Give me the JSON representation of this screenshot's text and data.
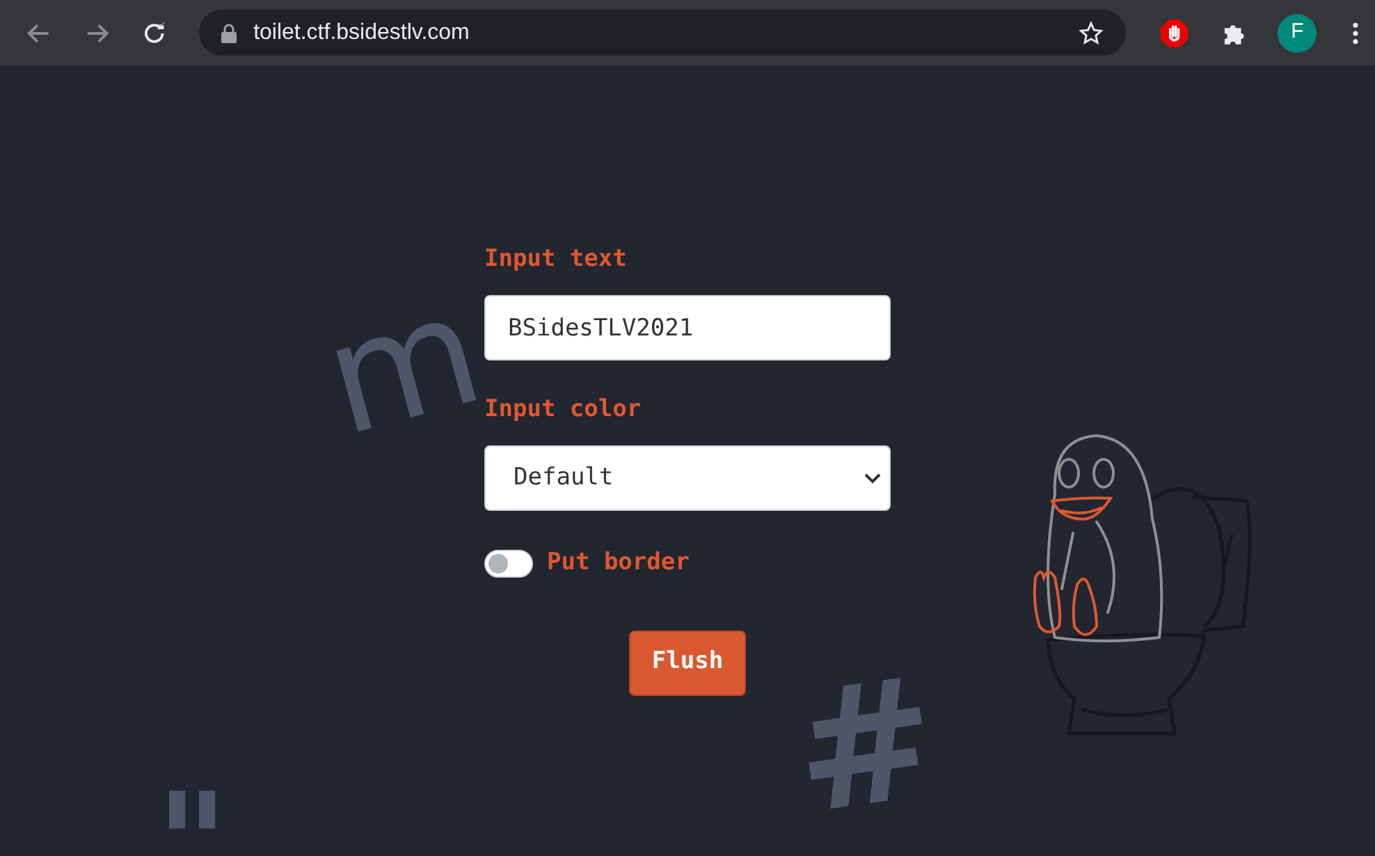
{
  "browser": {
    "url": "toilet.ctf.bsidestlv.com",
    "profile_initial": "F"
  },
  "form": {
    "text_label": "Input text",
    "text_value": "BSidesTLV2021",
    "color_label": "Input color",
    "color_value": "Default",
    "border_toggle": {
      "label": "Put border",
      "on": false
    },
    "submit": "Flush"
  },
  "background_glyphs": [
    {
      "text": "m"
    },
    {
      "text": "#"
    },
    {
      "text": "\""
    }
  ]
}
